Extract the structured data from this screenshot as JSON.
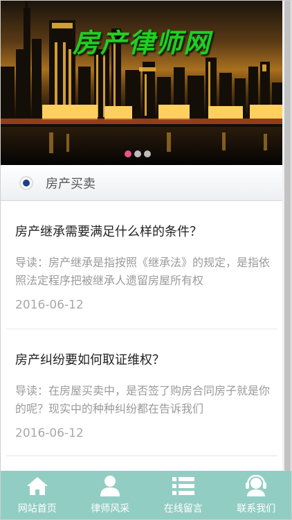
{
  "banner": {
    "title": "房产律师网",
    "slide_count": 3,
    "active_slide": 1
  },
  "section": {
    "title": "房产买卖"
  },
  "articles": [
    {
      "title": "房产继承需要满足什么样的条件？",
      "excerpt": "导读：房产继承是指按照《继承法》的规定，是指依照法定程序把被继承人遗留房屋所有权",
      "date": "2016-06-12"
    },
    {
      "title": "房产纠纷要如何取证维权？",
      "excerpt": "导读：在房屋买卖中，是否签了购房合同房子就是你的呢？现实中的种种纠纷都在告诉我们",
      "date": "2016-06-12"
    }
  ],
  "bottom_nav": [
    {
      "label": "网站首页",
      "icon": "home-icon"
    },
    {
      "label": "律师风采",
      "icon": "user-icon"
    },
    {
      "label": "在线留言",
      "icon": "list-icon"
    },
    {
      "label": "联系我们",
      "icon": "headset-icon"
    }
  ],
  "colors": {
    "nav_background": "#92cdc3",
    "banner_title": "#1fcf24",
    "active_dot": "#e8548a",
    "radio": "#1d3f8f"
  }
}
